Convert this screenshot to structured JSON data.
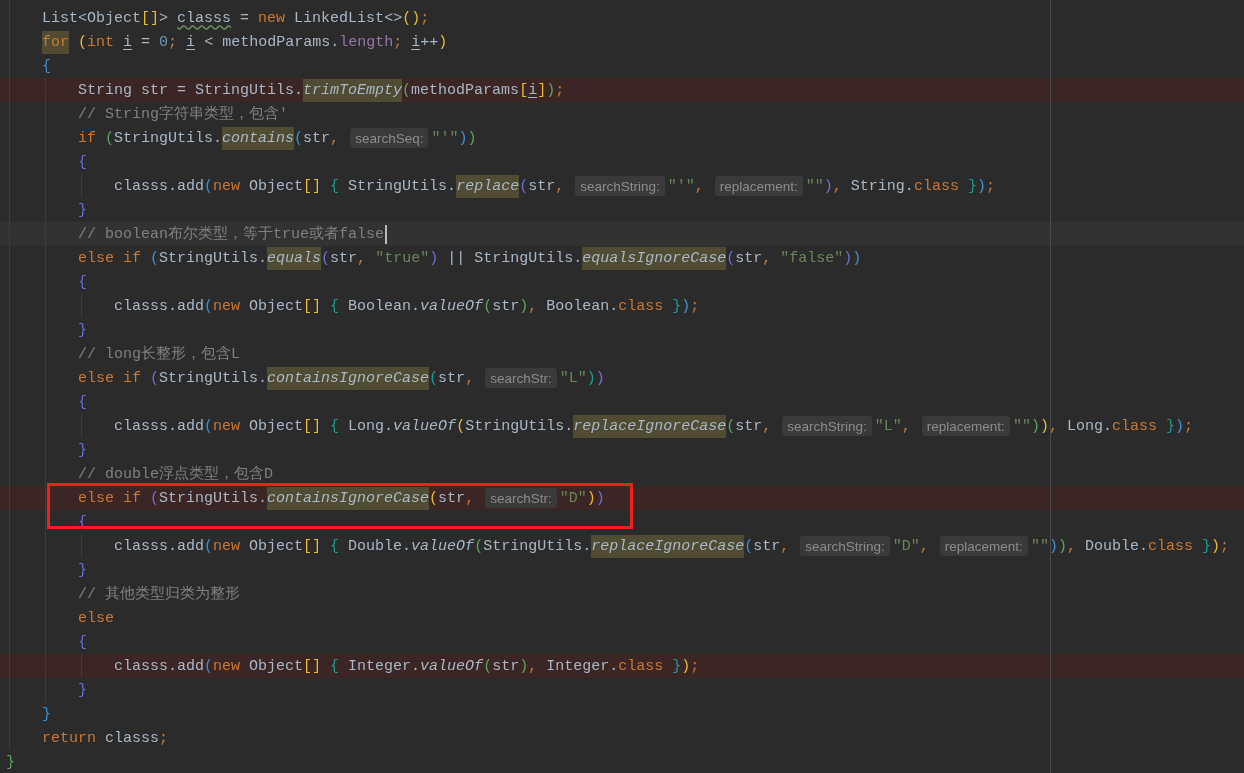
{
  "editor": {
    "body_lines": [
      {
        "tokens": [
          {
            "text": "List<Object",
            "kind": "plain"
          },
          {
            "text": "[]",
            "kind": "bracket",
            "color": "#e8ba36"
          },
          {
            "text": "> ",
            "kind": "plain"
          },
          {
            "text": "classs",
            "kind": "typo"
          },
          {
            "text": " = ",
            "kind": "plain"
          },
          {
            "text": "new",
            "kind": "keyword"
          },
          {
            "text": " LinkedList<>",
            "kind": "plain"
          },
          {
            "text": "()",
            "kind": "bracket",
            "color": "#e8ba36"
          },
          {
            "text": ";",
            "kind": "punct"
          }
        ],
        "error": false,
        "current": false,
        "boxed": false
      },
      {
        "tokens": [
          {
            "text": "for",
            "kind": "warning"
          },
          {
            "text": " (",
            "kind": "bracket",
            "color": "#e8ba36"
          },
          {
            "text": "int ",
            "kind": "keyword"
          },
          {
            "text": "i",
            "kind": "reassigned"
          },
          {
            "text": " = ",
            "kind": "plain"
          },
          {
            "text": "0",
            "kind": "number"
          },
          {
            "text": "; ",
            "kind": "punct"
          },
          {
            "text": "i",
            "kind": "reassigned"
          },
          {
            "text": " < methodParams.",
            "kind": "plain"
          },
          {
            "text": "length",
            "kind": "field"
          },
          {
            "text": "; ",
            "kind": "punct"
          },
          {
            "text": "i",
            "kind": "reassigned"
          },
          {
            "text": "++",
            "kind": "plain"
          },
          {
            "text": ")",
            "kind": "bracket",
            "color": "#e8ba36"
          }
        ],
        "error": false,
        "current": false,
        "boxed": false
      },
      {
        "tokens": [
          {
            "text": "{",
            "kind": "bracket",
            "color": "#3d8fd1"
          }
        ],
        "error": false,
        "current": false,
        "boxed": false,
        "children": [
          {
            "tokens": [
              {
                "text": "String str = StringUtils.",
                "kind": "plain"
              },
              {
                "text": "trimToEmpty",
                "kind": "method"
              },
              {
                "text": "(",
                "kind": "bracket",
                "color": "#5aa55a"
              },
              {
                "text": "methodParams",
                "kind": "plain"
              },
              {
                "text": "[",
                "kind": "bracket",
                "color": "#e8ba36"
              },
              {
                "text": "i",
                "kind": "reassigned"
              },
              {
                "text": "]",
                "kind": "bracket",
                "color": "#e8ba36"
              },
              {
                "text": ")",
                "kind": "bracket",
                "color": "#5aa55a"
              },
              {
                "text": ";",
                "kind": "punct"
              }
            ],
            "error": true,
            "current": false,
            "boxed": false
          },
          {
            "tokens": [
              {
                "text": "// String字符串类型，包含'",
                "kind": "comment"
              }
            ],
            "error": false,
            "current": false,
            "boxed": false
          },
          {
            "tokens": [
              {
                "text": "if",
                "kind": "keyword"
              },
              {
                "text": " (",
                "kind": "bracket",
                "color": "#5aa55a"
              },
              {
                "text": "StringUtils.",
                "kind": "plain"
              },
              {
                "text": "contains",
                "kind": "method"
              },
              {
                "text": "(",
                "kind": "bracket",
                "color": "#3d8fd1"
              },
              {
                "text": "str",
                "kind": "plain"
              },
              {
                "text": ",",
                "kind": "punct"
              },
              {
                "text": "searchSeq:",
                "kind": "hint"
              },
              {
                "text": "\"'\"",
                "kind": "string"
              },
              {
                "text": ")",
                "kind": "bracket",
                "color": "#3d8fd1"
              },
              {
                "text": ")",
                "kind": "bracket",
                "color": "#5aa55a"
              }
            ],
            "error": false,
            "current": false,
            "boxed": false
          },
          {
            "tokens": [
              {
                "text": "{",
                "kind": "bracket",
                "color": "#6c6fd8"
              }
            ],
            "error": false,
            "current": false,
            "boxed": false,
            "children": [
              {
                "tokens": [
                  {
                    "text": "classs.add",
                    "kind": "plain"
                  },
                  {
                    "text": "(",
                    "kind": "bracket",
                    "color": "#3d8fd1"
                  },
                  {
                    "text": "new",
                    "kind": "keyword"
                  },
                  {
                    "text": " Object",
                    "kind": "plain"
                  },
                  {
                    "text": "[]",
                    "kind": "bracket",
                    "color": "#e8ba36"
                  },
                  {
                    "text": " {",
                    "kind": "bracket",
                    "color": "#1a9f94"
                  },
                  {
                    "text": " StringUtils.",
                    "kind": "plain"
                  },
                  {
                    "text": "replace",
                    "kind": "method"
                  },
                  {
                    "text": "(",
                    "kind": "bracket",
                    "color": "#6c6fd8"
                  },
                  {
                    "text": "str",
                    "kind": "plain"
                  },
                  {
                    "text": ",",
                    "kind": "punct"
                  },
                  {
                    "text": "searchString:",
                    "kind": "hint"
                  },
                  {
                    "text": "\"'\"",
                    "kind": "string"
                  },
                  {
                    "text": ",",
                    "kind": "punct"
                  },
                  {
                    "text": "replacement:",
                    "kind": "hint"
                  },
                  {
                    "text": "\"\"",
                    "kind": "string"
                  },
                  {
                    "text": ")",
                    "kind": "bracket",
                    "color": "#6c6fd8"
                  },
                  {
                    "text": ",",
                    "kind": "punct"
                  },
                  {
                    "text": " String.",
                    "kind": "plain"
                  },
                  {
                    "text": "class",
                    "kind": "keyword"
                  },
                  {
                    "text": " }",
                    "kind": "bracket",
                    "color": "#1a9f94"
                  },
                  {
                    "text": ")",
                    "kind": "bracket",
                    "color": "#3d8fd1"
                  },
                  {
                    "text": ";",
                    "kind": "punct"
                  }
                ],
                "error": false,
                "current": false,
                "boxed": false
              }
            ]
          },
          {
            "tokens": [
              {
                "text": "}",
                "kind": "bracket",
                "color": "#6c6fd8"
              }
            ],
            "error": false,
            "current": false,
            "boxed": false
          },
          {
            "tokens": [
              {
                "text": "// boolean布尔类型，等于true或者false",
                "kind": "comment"
              }
            ],
            "error": false,
            "current": true,
            "boxed": false
          },
          {
            "tokens": [
              {
                "text": "else if",
                "kind": "keyword"
              },
              {
                "text": " (",
                "kind": "bracket",
                "color": "#3d8fd1"
              },
              {
                "text": "StringUtils.",
                "kind": "plain"
              },
              {
                "text": "equals",
                "kind": "method"
              },
              {
                "text": "(",
                "kind": "bracket",
                "color": "#6c6fd8"
              },
              {
                "text": "str",
                "kind": "plain"
              },
              {
                "text": ", ",
                "kind": "punct"
              },
              {
                "text": "\"true\"",
                "kind": "string"
              },
              {
                "text": ")",
                "kind": "bracket",
                "color": "#6c6fd8"
              },
              {
                "text": " || StringUtils.",
                "kind": "plain"
              },
              {
                "text": "equalsIgnoreCase",
                "kind": "method"
              },
              {
                "text": "(",
                "kind": "bracket",
                "color": "#6c6fd8"
              },
              {
                "text": "str",
                "kind": "plain"
              },
              {
                "text": ", ",
                "kind": "punct"
              },
              {
                "text": "\"false\"",
                "kind": "string"
              },
              {
                "text": ")",
                "kind": "bracket",
                "color": "#6c6fd8"
              },
              {
                "text": ")",
                "kind": "bracket",
                "color": "#3d8fd1"
              }
            ],
            "error": false,
            "current": false,
            "boxed": false
          },
          {
            "tokens": [
              {
                "text": "{",
                "kind": "bracket",
                "color": "#6c6fd8"
              }
            ],
            "error": false,
            "current": false,
            "boxed": false,
            "children": [
              {
                "tokens": [
                  {
                    "text": "classs.add",
                    "kind": "plain"
                  },
                  {
                    "text": "(",
                    "kind": "bracket",
                    "color": "#3d8fd1"
                  },
                  {
                    "text": "new",
                    "kind": "keyword"
                  },
                  {
                    "text": " Object",
                    "kind": "plain"
                  },
                  {
                    "text": "[]",
                    "kind": "bracket",
                    "color": "#e8ba36"
                  },
                  {
                    "text": " {",
                    "kind": "bracket",
                    "color": "#1a9f94"
                  },
                  {
                    "text": " Boolean.",
                    "kind": "plain"
                  },
                  {
                    "text": "valueOf",
                    "kind": "static"
                  },
                  {
                    "text": "(",
                    "kind": "bracket",
                    "color": "#5aa55a"
                  },
                  {
                    "text": "str",
                    "kind": "plain"
                  },
                  {
                    "text": ")",
                    "kind": "bracket",
                    "color": "#5aa55a"
                  },
                  {
                    "text": ",",
                    "kind": "punct"
                  },
                  {
                    "text": " Boolean.",
                    "kind": "plain"
                  },
                  {
                    "text": "class",
                    "kind": "keyword"
                  },
                  {
                    "text": " }",
                    "kind": "bracket",
                    "color": "#1a9f94"
                  },
                  {
                    "text": ")",
                    "kind": "bracket",
                    "color": "#3d8fd1"
                  },
                  {
                    "text": ";",
                    "kind": "punct"
                  }
                ],
                "error": false,
                "current": false,
                "boxed": false
              }
            ]
          },
          {
            "tokens": [
              {
                "text": "}",
                "kind": "bracket",
                "color": "#6c6fd8"
              }
            ],
            "error": false,
            "current": false,
            "boxed": false
          },
          {
            "tokens": [
              {
                "text": "// long长整形，包含L",
                "kind": "comment"
              }
            ],
            "error": false,
            "current": false,
            "boxed": false
          },
          {
            "tokens": [
              {
                "text": "else if",
                "kind": "keyword"
              },
              {
                "text": " (",
                "kind": "bracket",
                "color": "#6c6fd8"
              },
              {
                "text": "StringUtils.",
                "kind": "plain"
              },
              {
                "text": "containsIgnoreCase",
                "kind": "method"
              },
              {
                "text": "(",
                "kind": "bracket",
                "color": "#1a9f94"
              },
              {
                "text": "str",
                "kind": "plain"
              },
              {
                "text": ",",
                "kind": "punct"
              },
              {
                "text": "searchStr:",
                "kind": "hint"
              },
              {
                "text": "\"L\"",
                "kind": "string"
              },
              {
                "text": ")",
                "kind": "bracket",
                "color": "#1a9f94"
              },
              {
                "text": ")",
                "kind": "bracket",
                "color": "#6c6fd8"
              }
            ],
            "error": false,
            "current": false,
            "boxed": false
          },
          {
            "tokens": [
              {
                "text": "{",
                "kind": "bracket",
                "color": "#6c6fd8"
              }
            ],
            "error": false,
            "current": false,
            "boxed": false,
            "children": [
              {
                "tokens": [
                  {
                    "text": "classs.add",
                    "kind": "plain"
                  },
                  {
                    "text": "(",
                    "kind": "bracket",
                    "color": "#3d8fd1"
                  },
                  {
                    "text": "new",
                    "kind": "keyword"
                  },
                  {
                    "text": " Object",
                    "kind": "plain"
                  },
                  {
                    "text": "[]",
                    "kind": "bracket",
                    "color": "#e8ba36"
                  },
                  {
                    "text": " {",
                    "kind": "bracket",
                    "color": "#1a9f94"
                  },
                  {
                    "text": " Long.",
                    "kind": "plain"
                  },
                  {
                    "text": "valueOf",
                    "kind": "static"
                  },
                  {
                    "text": "(",
                    "kind": "bracket",
                    "color": "#e8ba36"
                  },
                  {
                    "text": "StringUtils.",
                    "kind": "plain"
                  },
                  {
                    "text": "replaceIgnoreCase",
                    "kind": "method"
                  },
                  {
                    "text": "(",
                    "kind": "bracket",
                    "color": "#5aa55a"
                  },
                  {
                    "text": "str",
                    "kind": "plain"
                  },
                  {
                    "text": ",",
                    "kind": "punct"
                  },
                  {
                    "text": "searchString:",
                    "kind": "hint"
                  },
                  {
                    "text": "\"L\"",
                    "kind": "string"
                  },
                  {
                    "text": ",",
                    "kind": "punct"
                  },
                  {
                    "text": "replacement:",
                    "kind": "hint"
                  },
                  {
                    "text": "\"\"",
                    "kind": "string"
                  },
                  {
                    "text": ")",
                    "kind": "bracket",
                    "color": "#5aa55a"
                  },
                  {
                    "text": ")",
                    "kind": "bracket",
                    "color": "#e8ba36"
                  },
                  {
                    "text": ",",
                    "kind": "punct"
                  },
                  {
                    "text": " Long.",
                    "kind": "plain"
                  },
                  {
                    "text": "class",
                    "kind": "keyword"
                  },
                  {
                    "text": " }",
                    "kind": "bracket",
                    "color": "#1a9f94"
                  },
                  {
                    "text": ")",
                    "kind": "bracket",
                    "color": "#3d8fd1"
                  },
                  {
                    "text": ";",
                    "kind": "punct"
                  }
                ],
                "error": false,
                "current": false,
                "boxed": false
              }
            ]
          },
          {
            "tokens": [
              {
                "text": "}",
                "kind": "bracket",
                "color": "#6c6fd8"
              }
            ],
            "error": false,
            "current": false,
            "boxed": false
          },
          {
            "tokens": [
              {
                "text": "// double浮点类型，包含D",
                "kind": "comment"
              }
            ],
            "error": false,
            "current": false,
            "boxed": false
          },
          {
            "tokens": [
              {
                "text": "else if",
                "kind": "keyword"
              },
              {
                "text": " (",
                "kind": "bracket",
                "color": "#6c6fd8"
              },
              {
                "text": "StringUtils.",
                "kind": "plain"
              },
              {
                "text": "containsIgnoreCase",
                "kind": "method"
              },
              {
                "text": "(",
                "kind": "bracket",
                "color": "#e8ba36"
              },
              {
                "text": "str",
                "kind": "plain"
              },
              {
                "text": ",",
                "kind": "punct"
              },
              {
                "text": "searchStr:",
                "kind": "hint"
              },
              {
                "text": "\"D\"",
                "kind": "string"
              },
              {
                "text": ")",
                "kind": "bracket",
                "color": "#e8ba36"
              },
              {
                "text": ")",
                "kind": "bracket",
                "color": "#6c6fd8"
              }
            ],
            "error": true,
            "current": false,
            "boxed": true
          },
          {
            "tokens": [
              {
                "text": "{",
                "kind": "bracket",
                "color": "#6c6fd8"
              }
            ],
            "error": false,
            "current": false,
            "boxed": false,
            "children": [
              {
                "tokens": [
                  {
                    "text": "classs.add",
                    "kind": "plain"
                  },
                  {
                    "text": "(",
                    "kind": "bracket",
                    "color": "#3d8fd1"
                  },
                  {
                    "text": "new",
                    "kind": "keyword"
                  },
                  {
                    "text": " Object",
                    "kind": "plain"
                  },
                  {
                    "text": "[]",
                    "kind": "bracket",
                    "color": "#e8ba36"
                  },
                  {
                    "text": " {",
                    "kind": "bracket",
                    "color": "#1a9f94"
                  },
                  {
                    "text": " Double.",
                    "kind": "plain"
                  },
                  {
                    "text": "valueOf",
                    "kind": "static"
                  },
                  {
                    "text": "(",
                    "kind": "bracket",
                    "color": "#5aa55a"
                  },
                  {
                    "text": "StringUtils.",
                    "kind": "plain"
                  },
                  {
                    "text": "replaceIgnoreCase",
                    "kind": "method"
                  },
                  {
                    "text": "(",
                    "kind": "bracket",
                    "color": "#3d8fd1"
                  },
                  {
                    "text": "str",
                    "kind": "plain"
                  },
                  {
                    "text": ",",
                    "kind": "punct"
                  },
                  {
                    "text": "searchString:",
                    "kind": "hint"
                  },
                  {
                    "text": "\"D\"",
                    "kind": "string"
                  },
                  {
                    "text": ",",
                    "kind": "punct"
                  },
                  {
                    "text": "replacement:",
                    "kind": "hint"
                  },
                  {
                    "text": "\"\"",
                    "kind": "string"
                  },
                  {
                    "text": ")",
                    "kind": "bracket",
                    "color": "#3d8fd1"
                  },
                  {
                    "text": ")",
                    "kind": "bracket",
                    "color": "#5aa55a"
                  },
                  {
                    "text": ",",
                    "kind": "punct"
                  },
                  {
                    "text": " Double.",
                    "kind": "plain"
                  },
                  {
                    "text": "class",
                    "kind": "keyword"
                  },
                  {
                    "text": " }",
                    "kind": "bracket",
                    "color": "#1a9f94"
                  },
                  {
                    "text": ")",
                    "kind": "bracket",
                    "color": "#e8ba36"
                  },
                  {
                    "text": ";",
                    "kind": "punct"
                  }
                ],
                "error": false,
                "current": false,
                "boxed": false
              }
            ]
          },
          {
            "tokens": [
              {
                "text": "}",
                "kind": "bracket",
                "color": "#6c6fd8"
              }
            ],
            "error": false,
            "current": false,
            "boxed": false
          },
          {
            "tokens": [
              {
                "text": "// 其他类型归类为整形",
                "kind": "comment"
              }
            ],
            "error": false,
            "current": false,
            "boxed": false
          },
          {
            "tokens": [
              {
                "text": "else",
                "kind": "keyword"
              }
            ],
            "error": false,
            "current": false,
            "boxed": false
          },
          {
            "tokens": [
              {
                "text": "{",
                "kind": "bracket",
                "color": "#6c6fd8"
              }
            ],
            "error": false,
            "current": false,
            "boxed": false,
            "children": [
              {
                "tokens": [
                  {
                    "text": "classs.add",
                    "kind": "plain"
                  },
                  {
                    "text": "(",
                    "kind": "bracket",
                    "color": "#3d8fd1"
                  },
                  {
                    "text": "new",
                    "kind": "keyword"
                  },
                  {
                    "text": " Object",
                    "kind": "plain"
                  },
                  {
                    "text": "[]",
                    "kind": "bracket",
                    "color": "#e8ba36"
                  },
                  {
                    "text": " {",
                    "kind": "bracket",
                    "color": "#1a9f94"
                  },
                  {
                    "text": " Integer.",
                    "kind": "plain"
                  },
                  {
                    "text": "valueOf",
                    "kind": "static"
                  },
                  {
                    "text": "(",
                    "kind": "bracket",
                    "color": "#5aa55a"
                  },
                  {
                    "text": "str",
                    "kind": "plain"
                  },
                  {
                    "text": ")",
                    "kind": "bracket",
                    "color": "#5aa55a"
                  },
                  {
                    "text": ",",
                    "kind": "punct"
                  },
                  {
                    "text": " Integer.",
                    "kind": "plain"
                  },
                  {
                    "text": "class",
                    "kind": "keyword"
                  },
                  {
                    "text": " }",
                    "kind": "bracket",
                    "color": "#1a9f94"
                  },
                  {
                    "text": ")",
                    "kind": "bracket",
                    "color": "#e8ba36"
                  },
                  {
                    "text": ";",
                    "kind": "punct"
                  }
                ],
                "error": true,
                "current": false,
                "boxed": false
              }
            ]
          },
          {
            "tokens": [
              {
                "text": "}",
                "kind": "bracket",
                "color": "#6c6fd8"
              }
            ],
            "error": false,
            "current": false,
            "boxed": false
          }
        ]
      },
      {
        "tokens": [
          {
            "text": "}",
            "kind": "bracket",
            "color": "#3d8fd1"
          }
        ],
        "error": false,
        "current": false,
        "boxed": false
      },
      {
        "tokens": [
          {
            "text": "return",
            "kind": "keyword"
          },
          {
            "text": " classs",
            "kind": "plain"
          },
          {
            "text": ";",
            "kind": "punct"
          }
        ],
        "error": false,
        "current": false,
        "boxed": false
      }
    ],
    "closing_line": {
      "tokens": [
        {
          "text": "}",
          "kind": "bracket",
          "color": "#5aa55a"
        }
      ],
      "error": false,
      "current": false,
      "boxed": false
    }
  }
}
